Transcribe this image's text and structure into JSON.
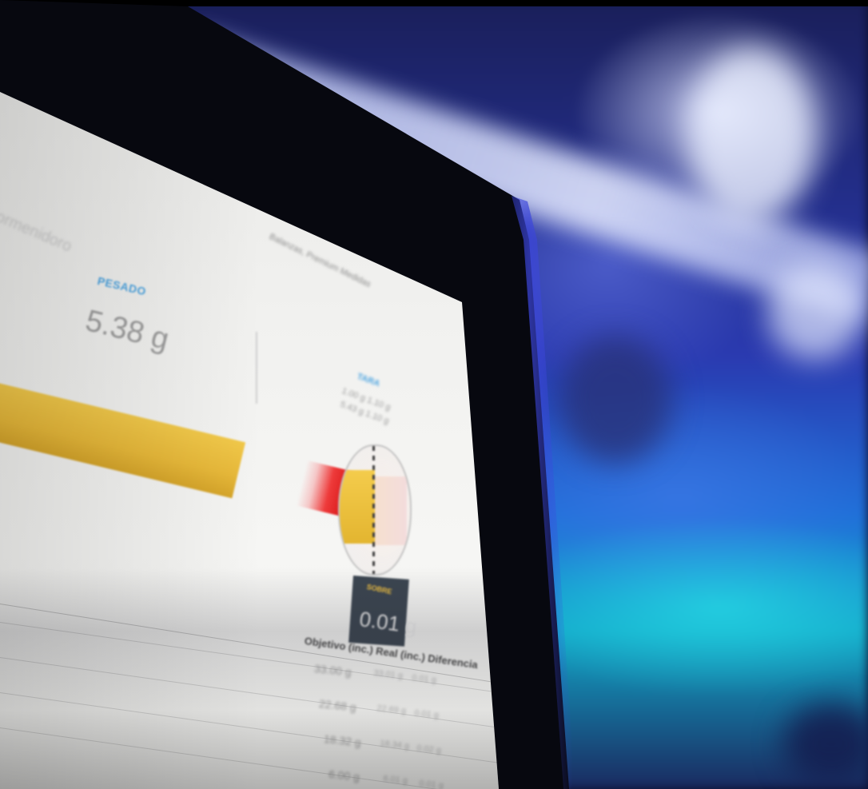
{
  "screen": {
    "breadcrumb": "ormenidoro",
    "header_right": "Balanzas, Premium Medidas",
    "weighed": {
      "label": "PESADO",
      "value": "5.38 g"
    },
    "tare": {
      "label": "TARA",
      "line1": "1.00 g   1.10 g",
      "line2": "5.43 g   1.10 g"
    },
    "bar": {
      "fill_fraction": 0.76,
      "colors": {
        "fill": "#e8b93a",
        "over": "#e23232"
      }
    },
    "over": {
      "label": "SOBRE",
      "value": "0.01 g"
    },
    "table": {
      "header": "Objetivo (inc.)   Real (inc.)   Diferencia",
      "rows": [
        {
          "target": "33.00 g",
          "real": "33.01 g",
          "diff": "0.01 g"
        },
        {
          "target": "22.68 g",
          "real": "22.69 g",
          "diff": "0.01 g"
        },
        {
          "target": "18.32 g",
          "real": "18.34 g",
          "diff": "0.02 g"
        },
        {
          "target": "6.00 g",
          "real": "6.01 g",
          "diff": "0.01 g"
        }
      ]
    }
  }
}
